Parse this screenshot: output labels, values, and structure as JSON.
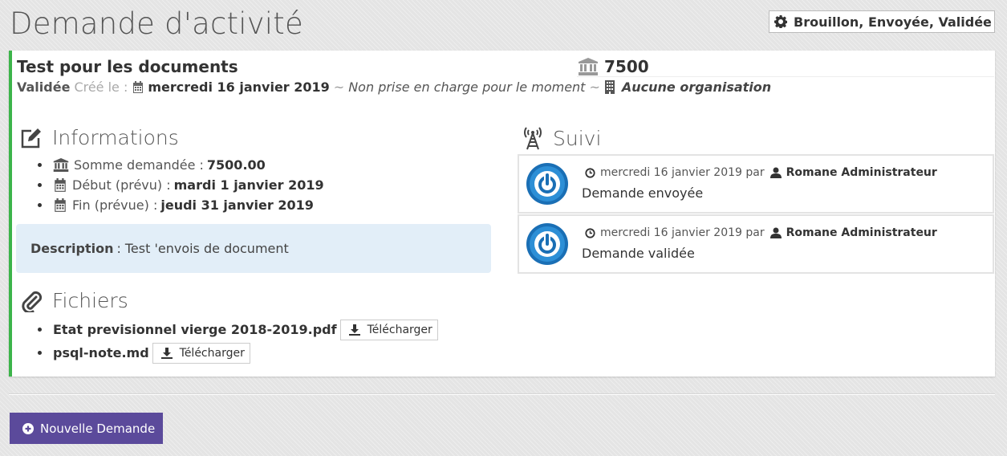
{
  "page_title": "Demande d'activité",
  "filter": {
    "label": "Brouillon, Envoyée, Validée",
    "icon": "gear-icon"
  },
  "request": {
    "title": "Test pour les documents",
    "amount": "7500",
    "status": "Validée",
    "created_label": "Créé le :",
    "created_date": "mercredi 16 janvier 2019",
    "handled": "Non prise en charge pour le moment",
    "organisation": "Aucune organisation",
    "accent_color": "#3cb44a"
  },
  "informations": {
    "title": "Informations",
    "items": [
      {
        "label": "Somme demandée :",
        "value": "7500.00",
        "icon": "bank-icon"
      },
      {
        "label": "Début (prévu) :",
        "value": "mardi 1 janvier 2019",
        "icon": "calendar-icon"
      },
      {
        "label": "Fin (prévue) :",
        "value": "jeudi 31 janvier 2019",
        "icon": "calendar-icon"
      }
    ],
    "description_label": "Description",
    "description_sep": ":",
    "description": "Test 'envois de document"
  },
  "fichiers": {
    "title": "Fichiers",
    "download_label": "Télécharger",
    "files": [
      {
        "name": "Etat previsionnel vierge 2018-2019.pdf"
      },
      {
        "name": "psql-note.md"
      }
    ]
  },
  "suivi": {
    "title": "Suivi",
    "entries": [
      {
        "date": "mercredi 16 janvier 2019 par",
        "user": "Romane Administrateur",
        "message": "Demande envoyée"
      },
      {
        "date": "mercredi 16 janvier 2019 par",
        "user": "Romane Administrateur",
        "message": "Demande validée"
      }
    ]
  },
  "new_request_label": "Nouvelle Demande",
  "button_color": "#5b4a9b"
}
